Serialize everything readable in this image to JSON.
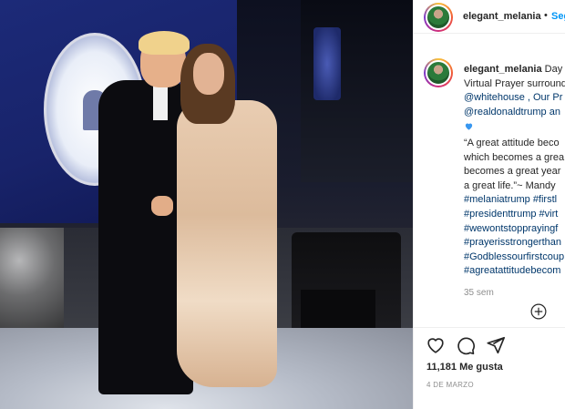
{
  "post": {
    "username": "elegant_melania",
    "header_separator": "•",
    "follow_label": "Seg",
    "photo_alt": "photo"
  },
  "caption": {
    "username": "elegant_melania",
    "lines": [
      "Day",
      "Virtual Prayer surround",
      "@whitehouse , Our Pr",
      "@realdonaldtrump an",
      "",
      "“A great attitude beco",
      "which becomes a grea",
      "becomes a great year",
      "a great life.”~ Mandy",
      "#melaniatrump #firstl",
      "#presidenttrump #virt",
      "#wewontstopprayingf",
      "#prayerisstrongerthan",
      "#Godblessourfirstcoup",
      "#agreatattitudebecom"
    ],
    "time": "35 sem"
  },
  "actions": {
    "likes": "11,181 Me gusta",
    "date": "4 DE MARZO"
  },
  "icons": {
    "heart_emoji": "blue-heart-icon",
    "like": "heart-icon",
    "comment": "comment-icon",
    "share": "paper-plane-icon",
    "add": "plus-circle-icon"
  },
  "colors": {
    "link": "#00376b",
    "follow": "#0095f6",
    "heart": "#3897f0",
    "muted": "#8e8e8e"
  }
}
